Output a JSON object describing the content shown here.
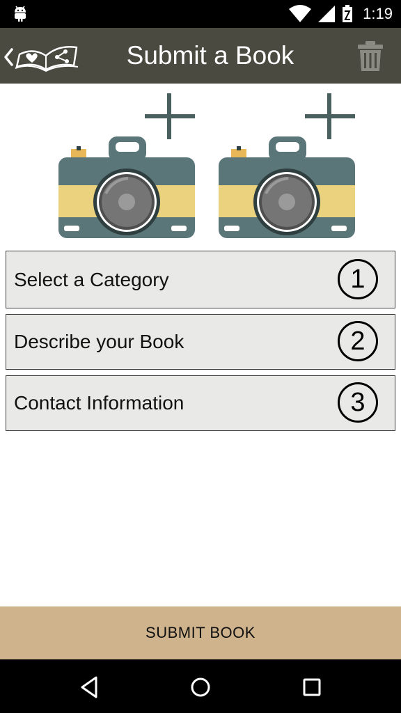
{
  "status_bar": {
    "time": "1:19",
    "icons": [
      "android-icon",
      "wifi-icon",
      "signal-icon",
      "battery-icon"
    ]
  },
  "app_bar": {
    "title": "Submit a Book",
    "back_icon": "chevron-left-icon",
    "logo_icon": "open-book-heart-share-icon",
    "action_icon": "trash-icon"
  },
  "photos": [
    {
      "icon": "add-photo-camera-icon"
    },
    {
      "icon": "add-photo-camera-icon"
    }
  ],
  "steps": [
    {
      "label": "Select a Category",
      "number": "1"
    },
    {
      "label": "Describe your Book",
      "number": "2"
    },
    {
      "label": "Contact Information",
      "number": "3"
    }
  ],
  "submit": {
    "label": "SUBMIT BOOK"
  },
  "nav": {
    "icons": [
      "back-triangle-icon",
      "home-circle-icon",
      "recents-square-icon"
    ]
  },
  "colors": {
    "app_bar": "#4a4a41",
    "submit_bar": "#cfb38c",
    "row_bg": "#e9e9e7",
    "camera_body": "#5a7679",
    "camera_stripe": "#ead27f",
    "plus": "#4a605f"
  }
}
